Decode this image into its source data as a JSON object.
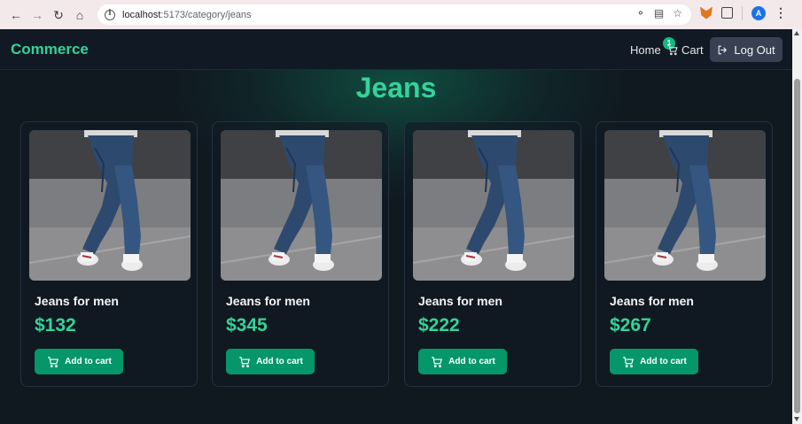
{
  "browser": {
    "url_host": "localhost",
    "url_path": ":5173/category/jeans",
    "profile_initial": "A"
  },
  "app": {
    "brand": "Commerce",
    "nav": {
      "home_label": "Home",
      "cart_label": "Cart",
      "cart_count": "1",
      "logout_label": "Log Out"
    },
    "page_title": "Jeans",
    "add_to_cart_label": "Add to cart",
    "products": [
      {
        "name": "Jeans for men",
        "price": "$132",
        "image": "jeans-photo"
      },
      {
        "name": "Jeans for men",
        "price": "$345",
        "image": "jeans-photo"
      },
      {
        "name": "Jeans for men",
        "price": "$222",
        "image": "jeans-photo"
      },
      {
        "name": "Jeans for men",
        "price": "$267",
        "image": "jeans-photo"
      }
    ]
  },
  "colors": {
    "accent": "#34d399",
    "button": "#059669",
    "background": "#101820",
    "logout_bg": "#374151"
  }
}
